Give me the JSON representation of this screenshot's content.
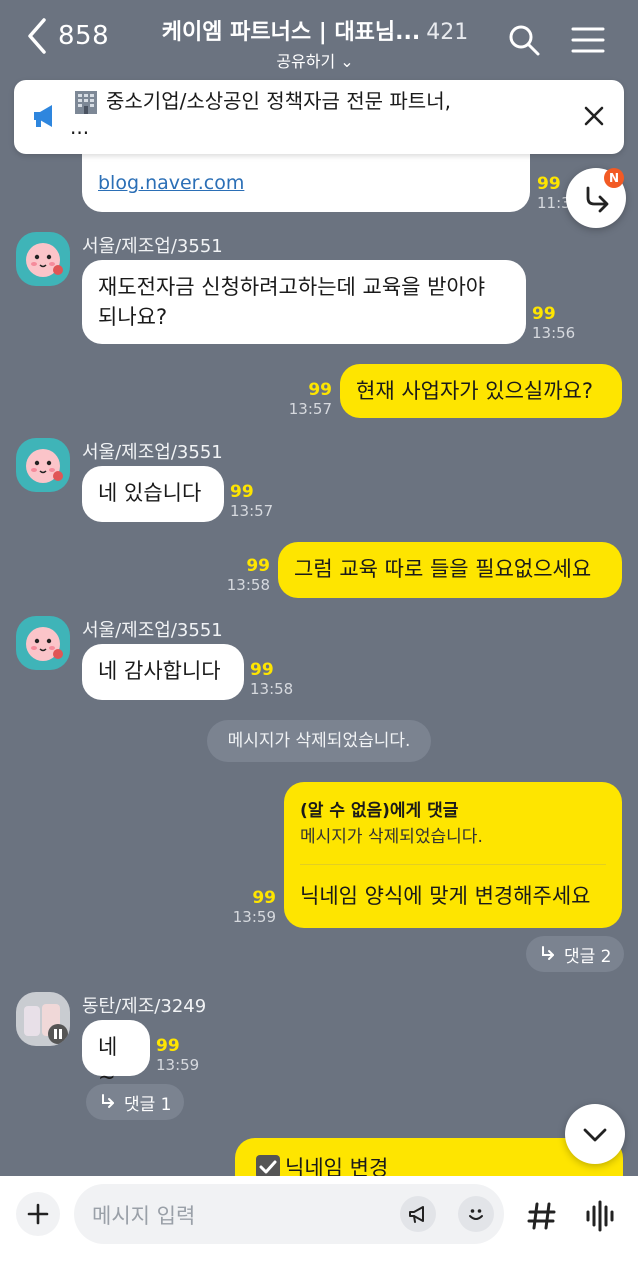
{
  "header": {
    "back_count": "858",
    "title": "케이엠 파트너스 | 대표님...",
    "member_count": "421",
    "share_label": "공유하기 ⌄"
  },
  "notice": {
    "line1": "중소기업/소상공인 정책자금 전문 파트너,",
    "line2": "..."
  },
  "link_preview": {
    "url": "blog.naver.com",
    "unread": "99",
    "time": "11:3"
  },
  "messages": [
    {
      "sender": "서울/제조업/3551",
      "text_l1": "재도전자금 신청하려고하는데 교육을 받아야",
      "text_l2": "되나요?",
      "unread": "99",
      "time": "13:56"
    },
    {
      "text": "현재 사업자가 있으실까요?",
      "unread": "99",
      "time": "13:57"
    },
    {
      "sender": "서울/제조업/3551",
      "text": "네 있습니다",
      "unread": "99",
      "time": "13:57"
    },
    {
      "text": "그럼 교육 따로 들을 필요없으세요",
      "unread": "99",
      "time": "13:58"
    },
    {
      "sender": "서울/제조업/3551",
      "text": "네 감사합니다",
      "unread": "99",
      "time": "13:58"
    },
    {
      "system": "메시지가 삭제되었습니다."
    },
    {
      "reply_to": "(알 수 없음)에게 댓글",
      "reply_orig": "메시지가 삭제되었습니다.",
      "text": "닉네임 양식에 맞게 변경해주세요",
      "unread": "99",
      "time": "13:59",
      "thread": "댓글 2"
    },
    {
      "sender": "동탄/제조/3249",
      "text": "네~",
      "unread": "99",
      "time": "13:59",
      "thread": "댓글 1"
    },
    {
      "text": "닉네임 변경"
    }
  ],
  "badge": "N",
  "input": {
    "placeholder": "메시지 입력"
  },
  "colors": {
    "background": "#6b7380",
    "bubble_out": "#fee500",
    "bubble_in": "#ffffff",
    "unread": "#fee500",
    "link": "#2b6fb6"
  },
  "icons": [
    "back-icon",
    "search-icon",
    "menu-icon",
    "megaphone-icon",
    "building-icon",
    "close-icon",
    "share-arrow-icon",
    "chevron-down-icon",
    "plus-icon",
    "announce-icon",
    "emoji-icon",
    "hash-icon",
    "voice-icon",
    "reply-arrow-icon",
    "checkbox-icon"
  ]
}
